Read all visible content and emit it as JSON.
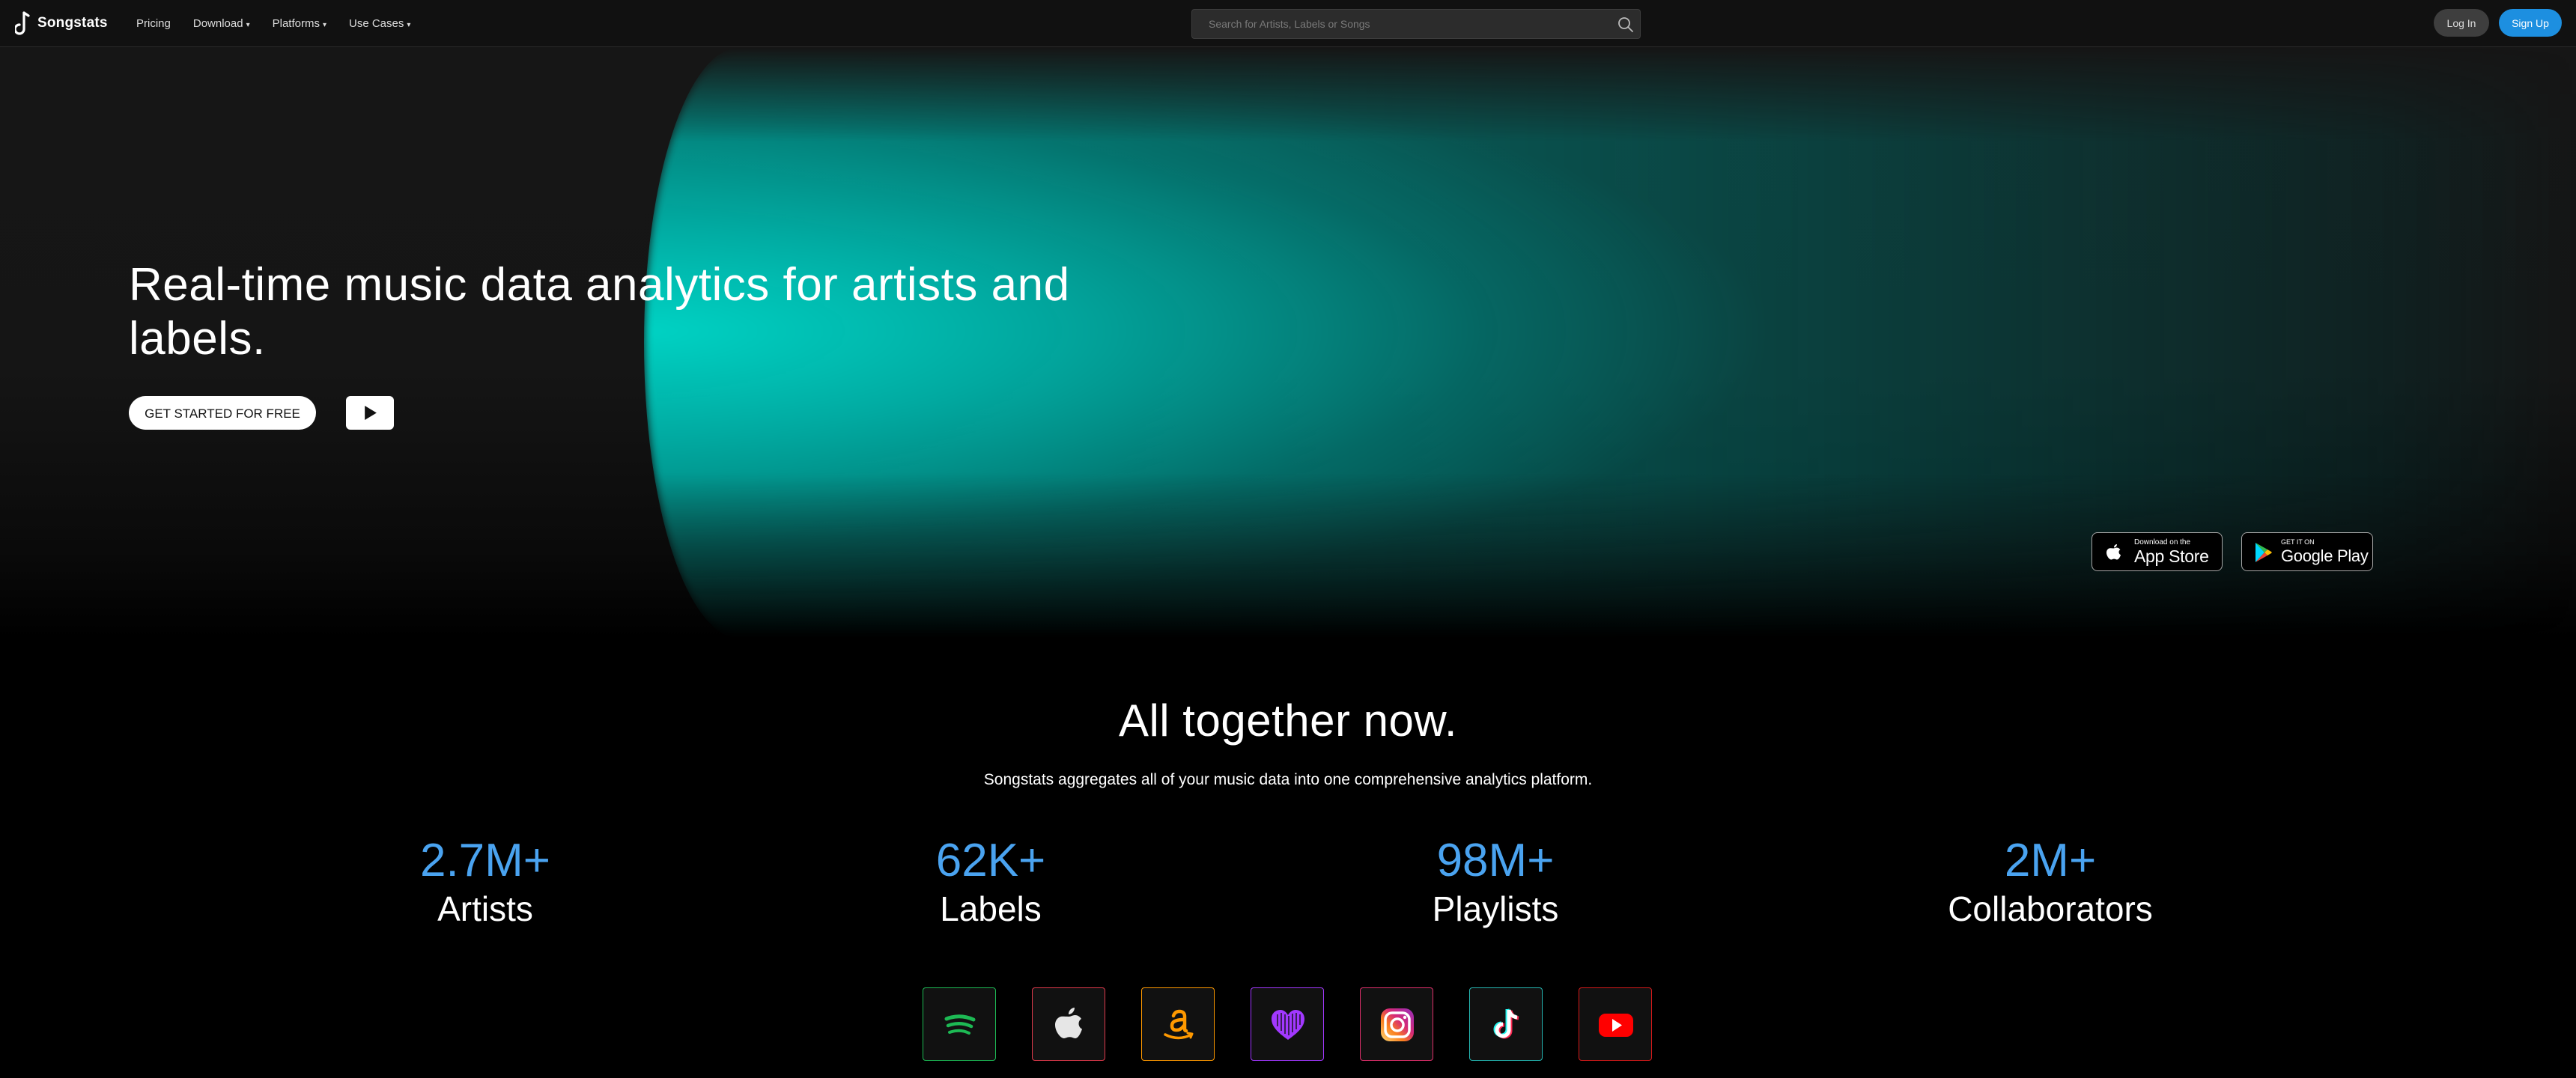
{
  "nav": {
    "logo_text": "Songstats",
    "links": [
      {
        "label": "Pricing",
        "caret": ""
      },
      {
        "label": "Download",
        "caret": "▾"
      },
      {
        "label": "Platforms",
        "caret": "▾"
      },
      {
        "label": "Use Cases",
        "caret": "▾"
      }
    ],
    "search_placeholder": "Search for Artists, Labels or Songs",
    "login_label": "Log In",
    "signup_label": "Sign Up"
  },
  "hero": {
    "title": "Real-time music data analytics for artists and labels.",
    "cta_label": "GET STARTED FOR FREE",
    "appstore": {
      "small": "Download on the",
      "big": "App Store"
    },
    "googleplay": {
      "small": "GET IT ON",
      "big": "Google Play"
    }
  },
  "together": {
    "title": "All together now.",
    "subtitle": "Songstats aggregates all of your music data into one comprehensive analytics platform.",
    "stats": [
      {
        "value": "2.7M+",
        "label": "Artists"
      },
      {
        "value": "62K+",
        "label": "Labels"
      },
      {
        "value": "98M+",
        "label": "Playlists"
      },
      {
        "value": "2M+",
        "label": "Collaborators"
      }
    ]
  },
  "platforms": [
    {
      "icon": "spotify-icon",
      "color": "#1db954"
    },
    {
      "icon": "apple-music-icon",
      "color": "#e03a4c"
    },
    {
      "icon": "amazon-music-icon",
      "color": "#ff9900"
    },
    {
      "icon": "deezer-icon",
      "color": "#a238ff"
    },
    {
      "icon": "instagram-icon",
      "color": "#e1306c"
    },
    {
      "icon": "tiktok-icon",
      "color": "#25f4ee"
    },
    {
      "icon": "youtube-icon",
      "color": "#ff0000"
    }
  ],
  "colors": {
    "accent": "#1d8fe0",
    "stat_blue": "#4aa3f0",
    "hero_glow": "#00d7c8"
  }
}
